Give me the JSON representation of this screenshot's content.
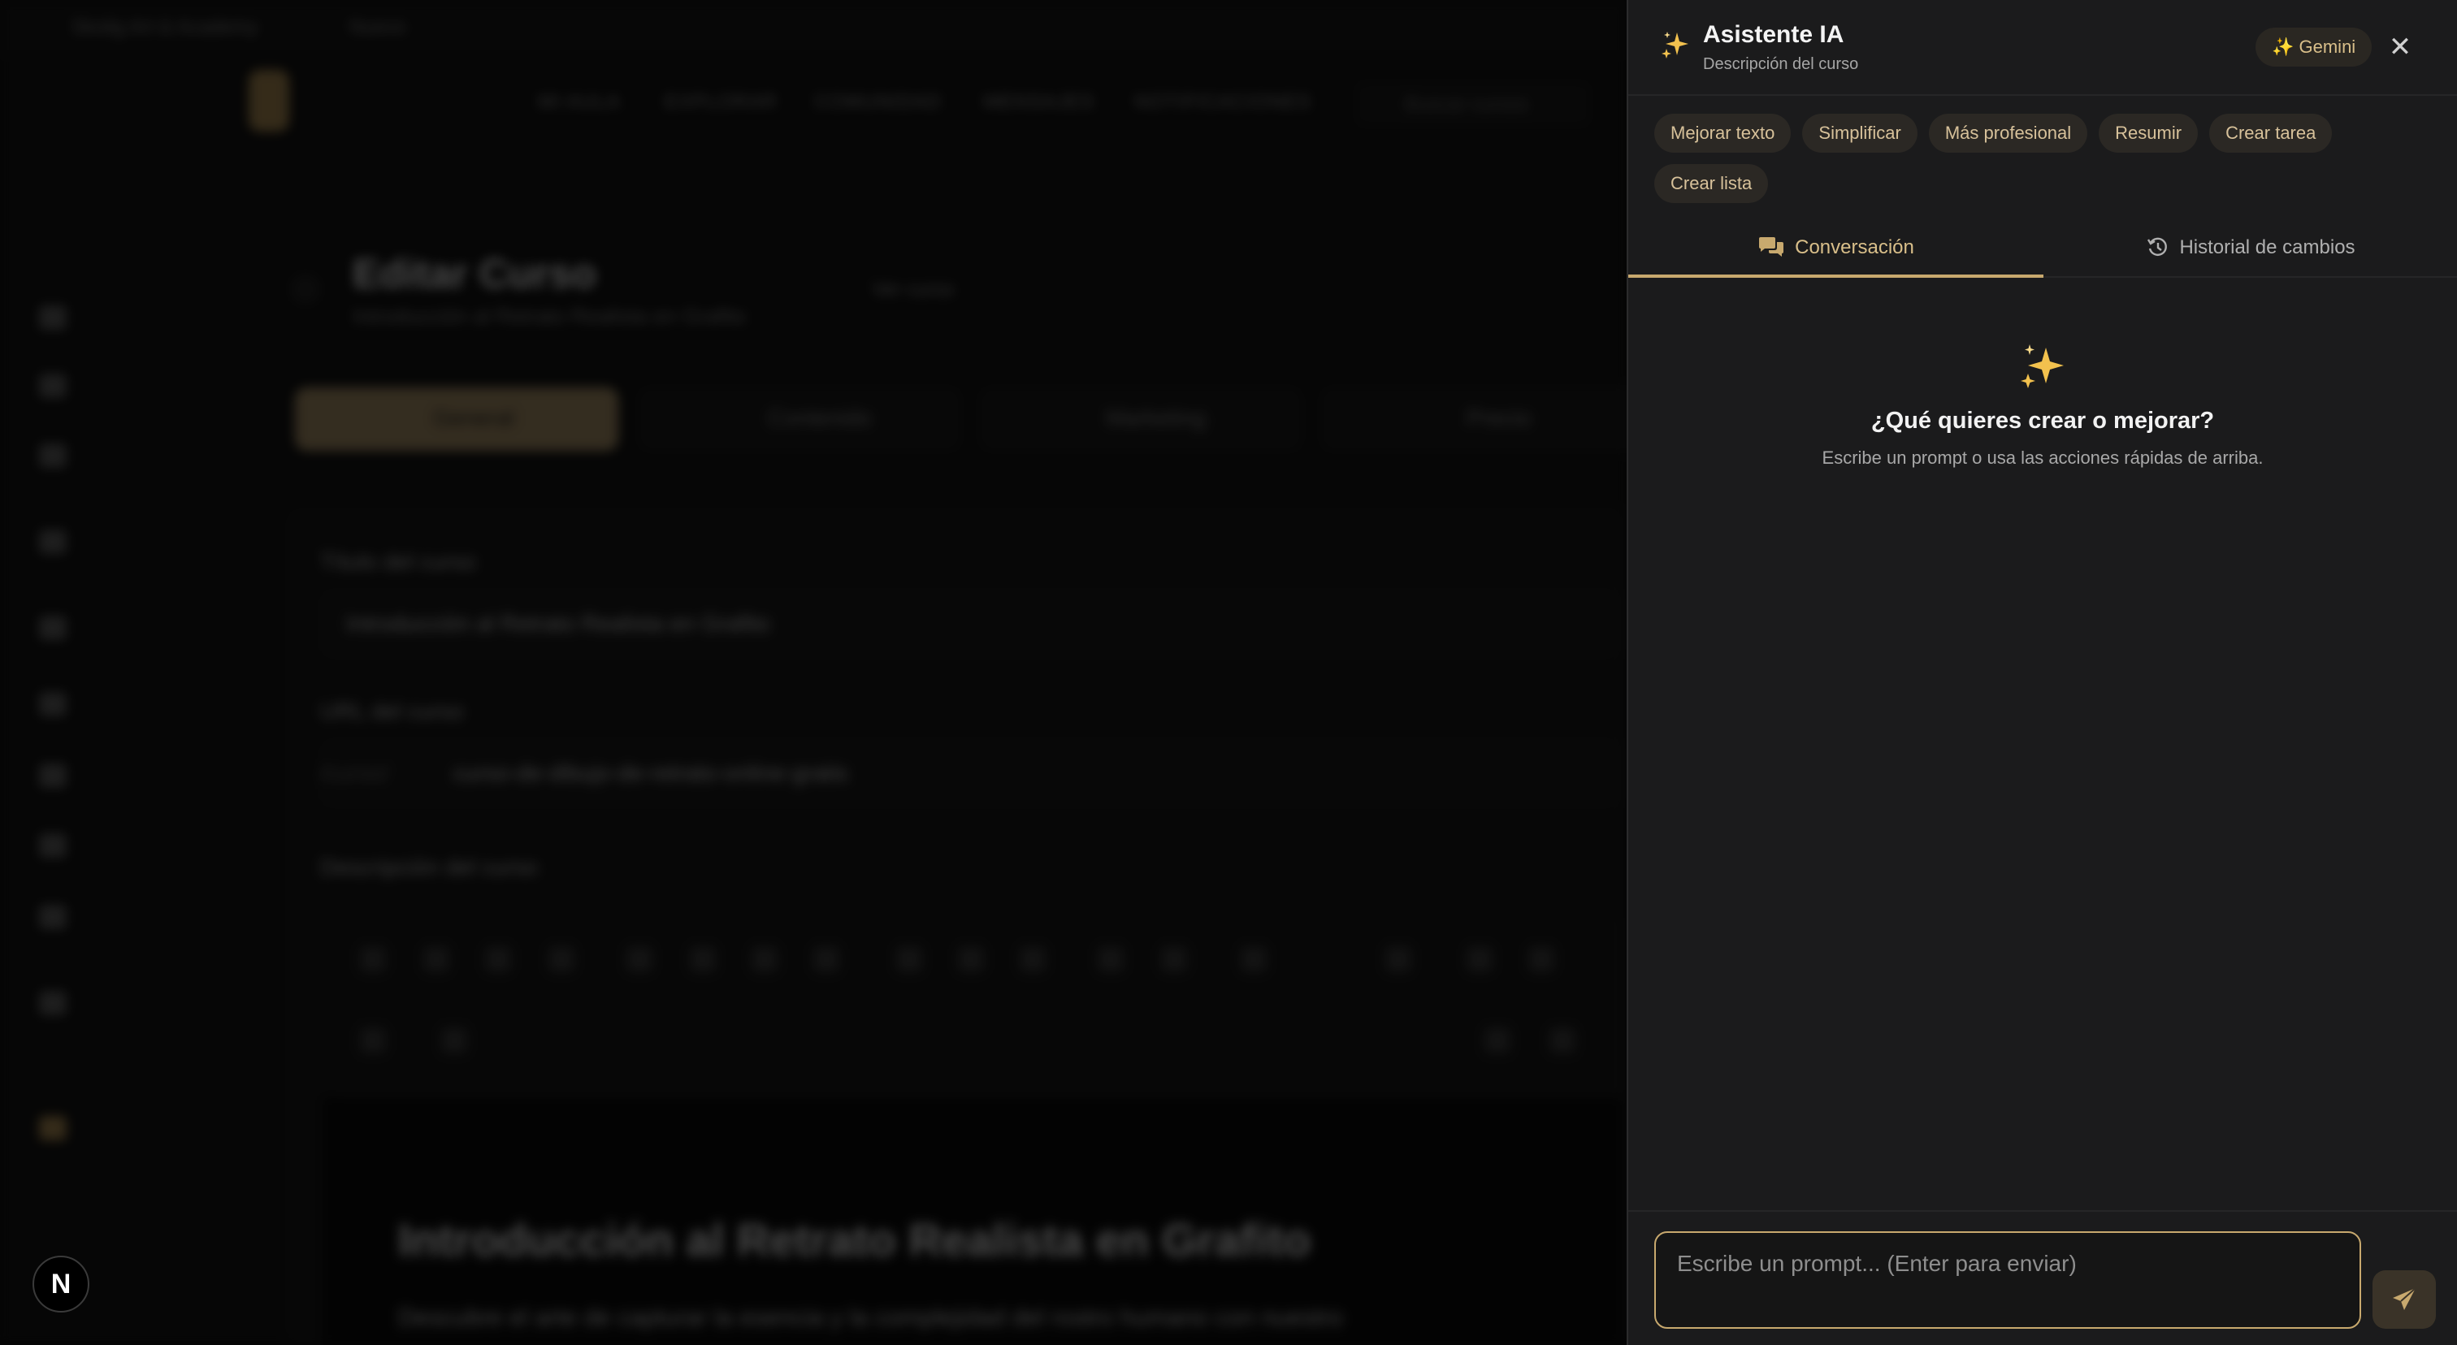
{
  "background": {
    "breadcrumb": [
      "Skolig Art & Academy",
      "Nuevo"
    ],
    "nav": [
      "MI AULA",
      "EXPLORAR",
      "COMUNIDAD",
      "MENSAJES",
      "NOTIFICACIONES"
    ],
    "search_placeholder": "Buscar cursos",
    "page_title": "Editar Curso",
    "page_subtitle": "Introducción al Retrato Realista en Grafito",
    "view_course": "Ver curso",
    "tabs": [
      "General",
      "Contenido",
      "Marketing",
      "Precio"
    ],
    "course_title_label": "Título del curso",
    "course_title_value": "Introducción al Retrato Realista en Grafito",
    "course_url_label": "URL del curso",
    "course_url_prefix": "/curso/",
    "course_url_value": "curso-de-dibujo-de-retrato-online-gratis",
    "course_description_label": "Descripción del curso",
    "editor_heading": "Introducción al Retrato Realista en Grafito",
    "editor_paragraph": "Descubre el arte de capturar la esencia y la complejidad del rostro humano con nuestro",
    "n_badge": "N"
  },
  "panel": {
    "title": "Asistente IA",
    "subtitle": "Descripción del curso",
    "model_badge": "✨ Gemini",
    "close_symbol": "✕",
    "quick_actions": [
      "Mejorar texto",
      "Simplificar",
      "Más profesional",
      "Resumir",
      "Crear tarea",
      "Crear lista"
    ],
    "tabs": {
      "conversation": "Conversación",
      "history": "Historial de cambios"
    },
    "empty_state": {
      "title": "¿Qué quieres crear o mejorar?",
      "subtitle": "Escribe un prompt o usa las acciones rápidas de arriba."
    },
    "prompt_placeholder": "Escribe un prompt... (Enter para enviar)",
    "colors": {
      "accent": "#c8a96e",
      "sparkle": "#f2c14e",
      "panel_bg": "#1b1b1c"
    },
    "icons": {
      "header": "sparkles-icon",
      "conversation_tab": "comments-icon",
      "history_tab": "history-icon",
      "send": "send-icon",
      "close": "close-icon"
    }
  }
}
